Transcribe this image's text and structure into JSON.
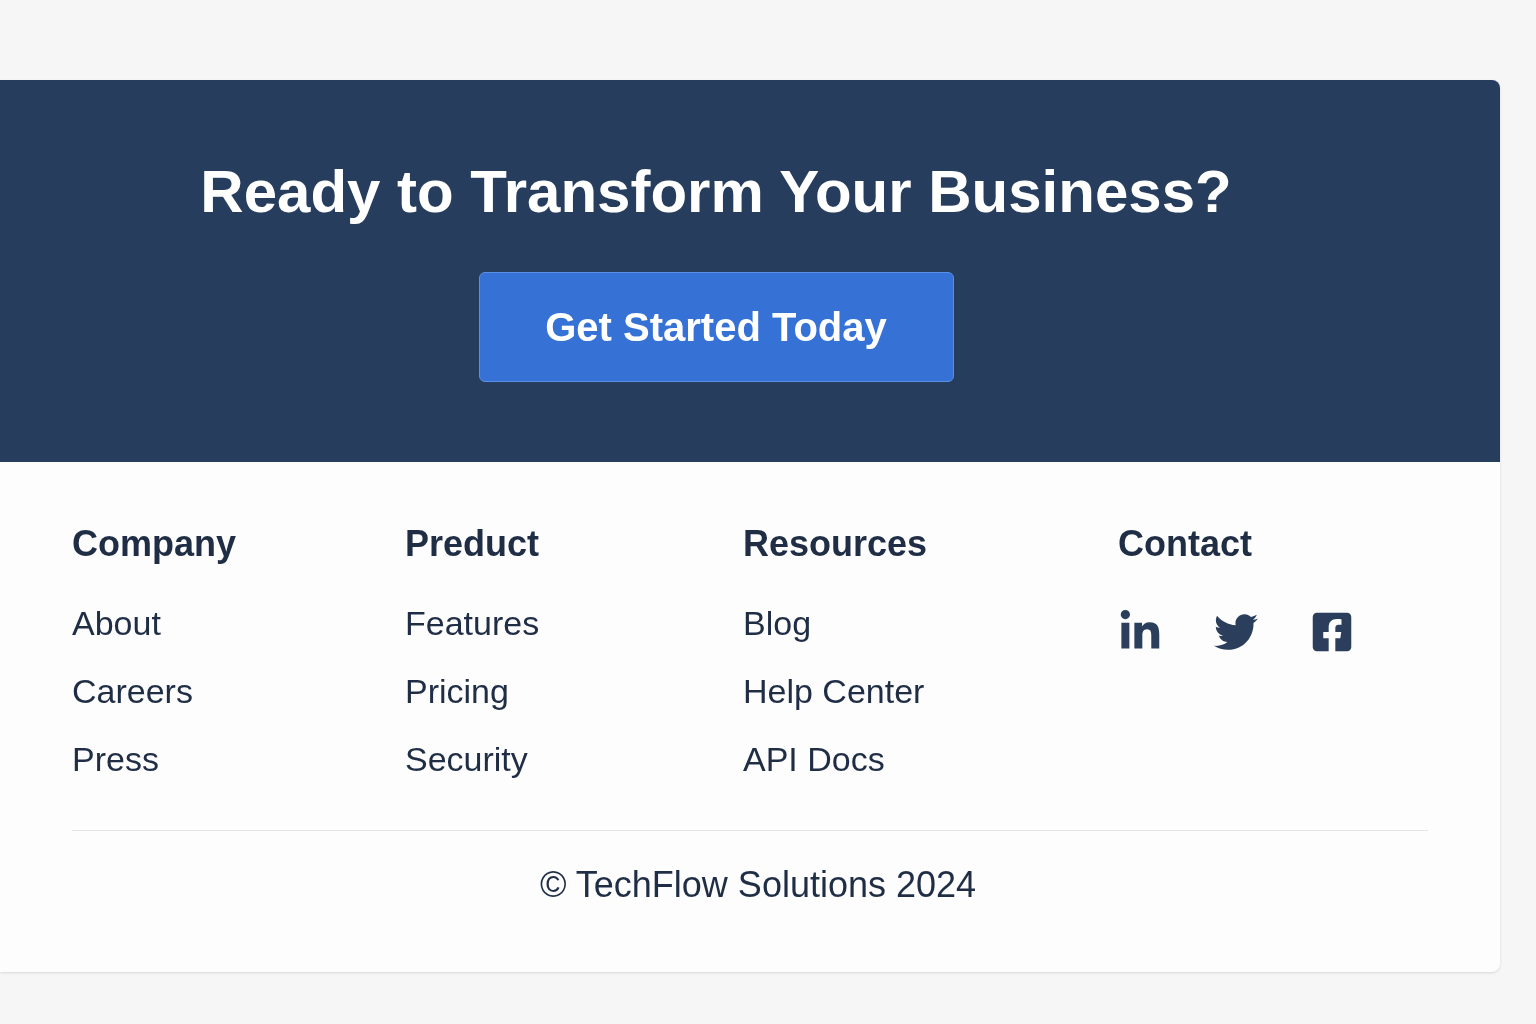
{
  "cta": {
    "heading": "Ready to Transform Your Business?",
    "button": "Get Started Today"
  },
  "footer": {
    "columns": [
      {
        "title": "Company",
        "links": [
          "About",
          "Careers",
          "Press"
        ]
      },
      {
        "title": "Preduct",
        "links": [
          "Features",
          "Pricing",
          "Security"
        ]
      },
      {
        "title": "Resources",
        "links": [
          "Blog",
          "Help Center",
          "API Docs"
        ]
      }
    ],
    "contact": {
      "title": "Contact",
      "social": [
        {
          "kind": "linkedin"
        },
        {
          "kind": "twitter"
        },
        {
          "kind": "facebook"
        }
      ]
    },
    "copyright": "© TechFlow Solutions 2024"
  }
}
